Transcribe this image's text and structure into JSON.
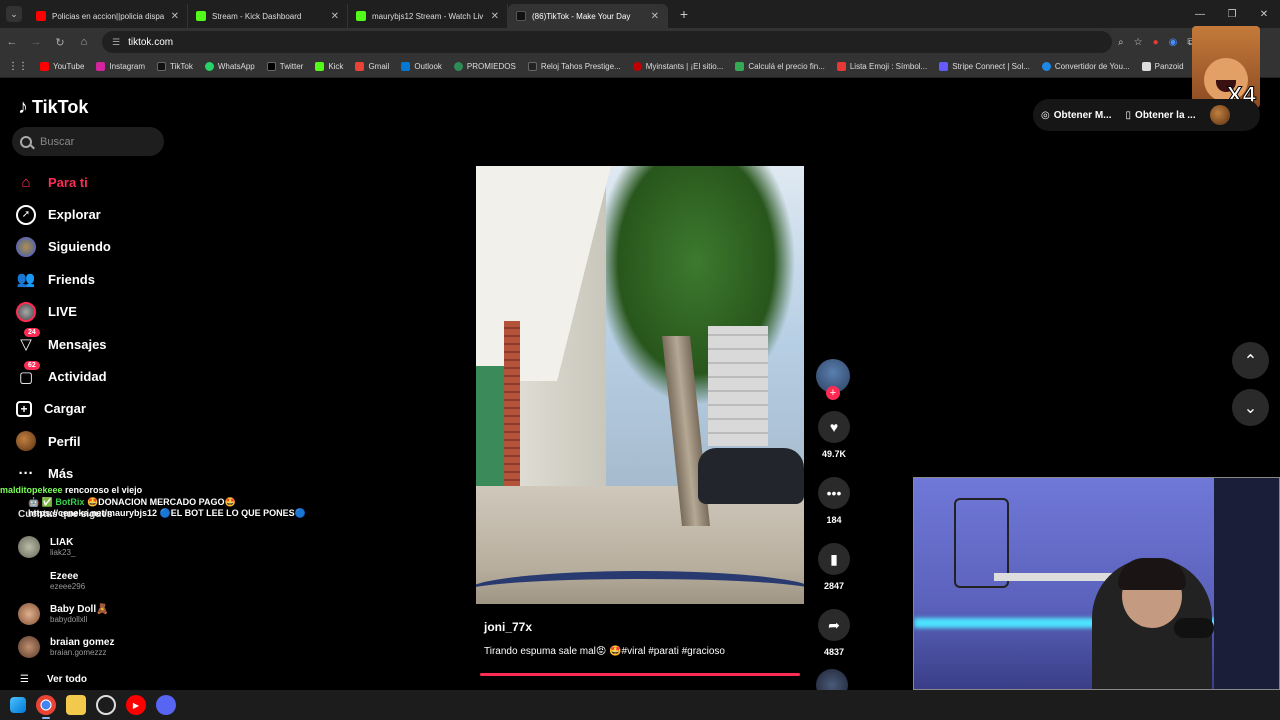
{
  "browser": {
    "tabs": [
      {
        "title": "Policias en accion||policia dispa",
        "fav_color": "#ff0000"
      },
      {
        "title": "Stream - Kick Dashboard",
        "fav_color": "#53fc18"
      },
      {
        "title": "maurybjs12 Stream - Watch Liv",
        "fav_color": "#53fc18"
      },
      {
        "title": "(86)TikTok - Make Your Day",
        "fav_color": "#111111",
        "active": true
      }
    ],
    "url": "tiktok.com",
    "bookmarks": [
      {
        "label": "YouTube",
        "color": "#ff0000"
      },
      {
        "label": "Instagram",
        "color": "#d6249f"
      },
      {
        "label": "TikTok",
        "color": "#111111"
      },
      {
        "label": "WhatsApp",
        "color": "#25d366"
      },
      {
        "label": "Twitter",
        "color": "#000000"
      },
      {
        "label": "Kick",
        "color": "#53fc18"
      },
      {
        "label": "Gmail",
        "color": "#ea4335"
      },
      {
        "label": "Outlook",
        "color": "#0078d4"
      },
      {
        "label": "PROMIEDOS",
        "color": "#2e8b57"
      },
      {
        "label": "Reloj Tahos Prestige...",
        "color": "#222222"
      },
      {
        "label": "Myinstants | ¡El sitio...",
        "color": "#c00000"
      },
      {
        "label": "Calculá el precio fin...",
        "color": "#34a853"
      },
      {
        "label": "Lista Emoji : Símbol...",
        "color": "#e53935"
      },
      {
        "label": "Stripe Connect | Sol...",
        "color": "#635bff"
      },
      {
        "label": "Convertidor de You...",
        "color": "#1e88e5"
      },
      {
        "label": "Panzoid",
        "color": "#dddddd"
      }
    ]
  },
  "emote": {
    "label": "X4"
  },
  "tiktok": {
    "logo": "TikTok",
    "search_placeholder": "Buscar",
    "nav": [
      {
        "label": "Para ti",
        "icon": "home-icon",
        "active": true
      },
      {
        "label": "Explorar",
        "icon": "compass-icon"
      },
      {
        "label": "Siguiendo",
        "icon": "following-avatar-icon"
      },
      {
        "label": "Friends",
        "icon": "friends-icon"
      },
      {
        "label": "LIVE",
        "icon": "live-icon"
      },
      {
        "label": "Mensajes",
        "icon": "messages-icon",
        "badge": "24"
      },
      {
        "label": "Actividad",
        "icon": "activity-icon",
        "badge": "62"
      },
      {
        "label": "Cargar",
        "icon": "upload-icon"
      },
      {
        "label": "Perfil",
        "icon": "profile-icon"
      },
      {
        "label": "Más",
        "icon": "more-icon"
      }
    ],
    "following_title": "Cuentas que sigues",
    "following": [
      {
        "name": "LIAK",
        "handle": "liak23_",
        "color": "#8a7a6a"
      },
      {
        "name": "Ezeee",
        "handle": "ezeee296",
        "color": ""
      },
      {
        "name": "Baby Doll🧸",
        "handle": "babydollxll",
        "color": "#c89070"
      },
      {
        "name": "braian gomez",
        "handle": "braian.gomezzz",
        "color": "#9a6a4a"
      }
    ],
    "see_all": "Ver todo",
    "top_buttons": {
      "get_coins": "Obtener M...",
      "get_app": "Obtener la ..."
    },
    "video": {
      "username": "joni_77x",
      "description": "Tirando espuma sale mal😡 🤩#viral #parati #gracioso",
      "likes": "49.7K",
      "comments": "184",
      "saves": "2847",
      "shares": "4837"
    }
  },
  "chat": [
    {
      "user": "malditopekeee",
      "message": "rencoroso el viejo"
    },
    {
      "user": "🤖 ✅ BotRix",
      "message": "🤩DONACION MERCADO PAGO🤩 https://ceneka.net/maurybjs12 🔵EL BOT LEE LO QUE PONES🔵"
    }
  ]
}
